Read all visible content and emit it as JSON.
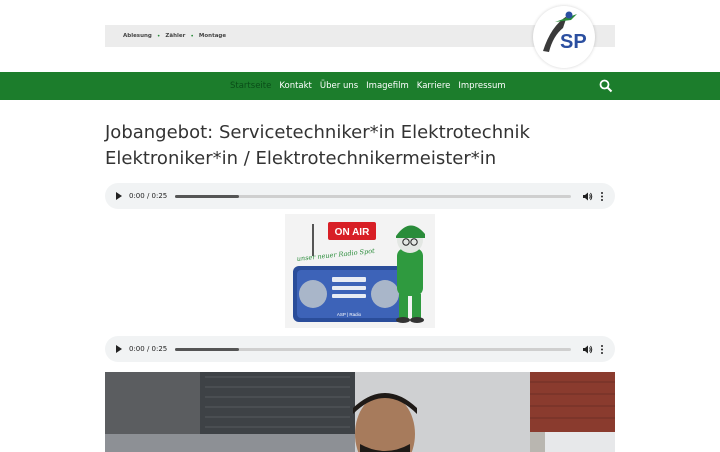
{
  "topbar": {
    "items": [
      "Ablesung",
      "Zähler",
      "Montage"
    ],
    "separator": "•"
  },
  "logo": {
    "text": "SP"
  },
  "nav": {
    "items": [
      "Startseite",
      "Kontakt",
      "Über uns",
      "Imagefilm",
      "Karriere",
      "Impressum"
    ],
    "active_index": 0,
    "search_icon": "search-icon"
  },
  "page": {
    "title_line1": "Jobangebot: Servicetechniker*in Elektrotechnik",
    "title_line2": "Elektroniker*in / Elektrotechnikermeister*in"
  },
  "audio_players": [
    {
      "time": "0:00 / 0:25",
      "progress": 0.16
    },
    {
      "time": "0:00 / 0:25",
      "progress": 0.16
    }
  ],
  "promo": {
    "badge": "ON AIR",
    "slogan": "unser neuer Radio Spot",
    "radio_label": "ASP | Radio"
  },
  "colors": {
    "brand_green": "#1c7d2c",
    "nav_active": "#0a4d18",
    "badge_red": "#d81f26",
    "radio_blue": "#2a4d9a"
  }
}
